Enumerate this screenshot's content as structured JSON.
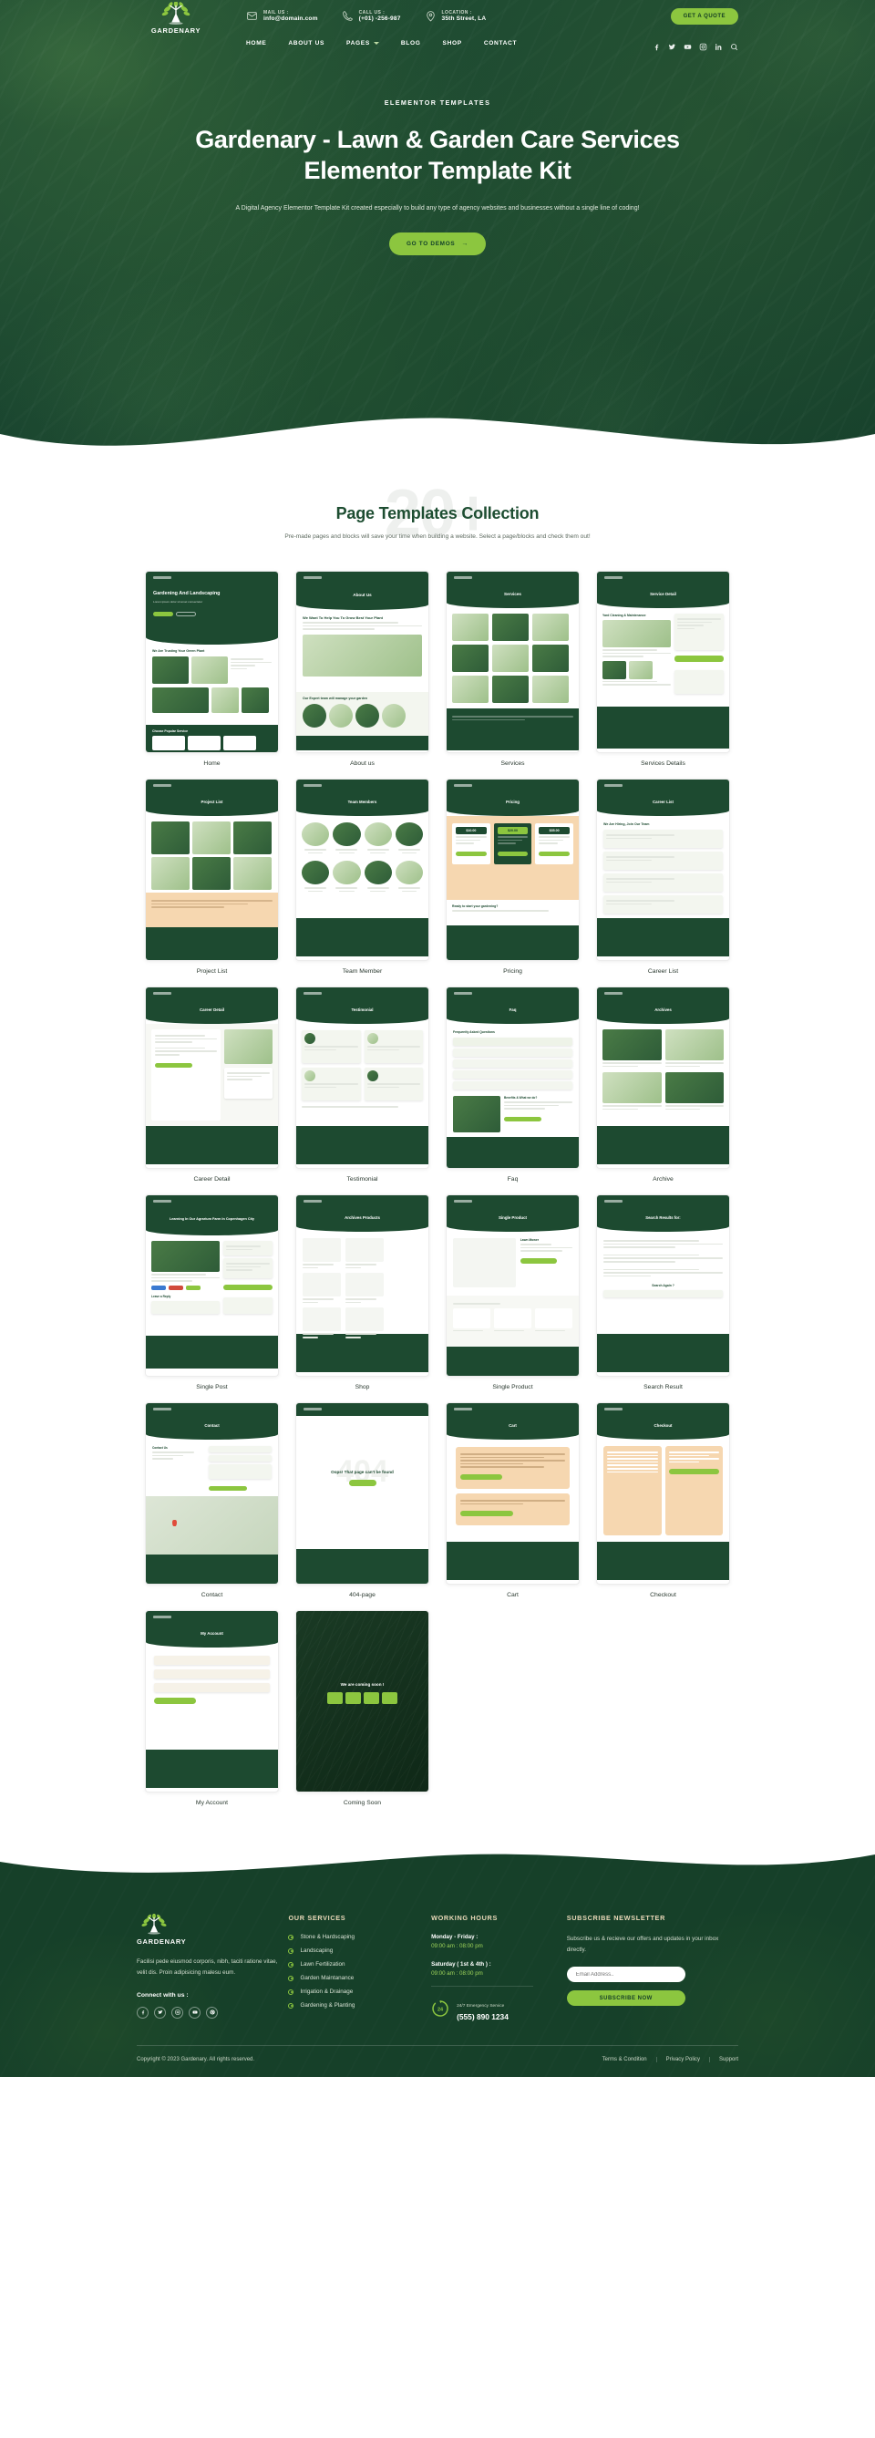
{
  "colors": {
    "brand_green": "#164029",
    "accent_lime": "#8cc63f",
    "dark_green": "#1d4a30",
    "cream": "#ead9b9"
  },
  "header": {
    "logo_name": "GARDENARY",
    "contacts": [
      {
        "icon": "envelope-icon",
        "label": "MAIL US :",
        "value": "info@domain.com"
      },
      {
        "icon": "phone-icon",
        "label": "CALL US :",
        "value": "(+01) -256-987"
      },
      {
        "icon": "map-pin-icon",
        "label": "LOCATION :",
        "value": "35th Street, LA"
      }
    ],
    "quote_button": "GET A QUOTE",
    "nav": [
      {
        "label": "HOME",
        "has_dropdown": false
      },
      {
        "label": "ABOUT US",
        "has_dropdown": false
      },
      {
        "label": "PAGES",
        "has_dropdown": true
      },
      {
        "label": "BLOG",
        "has_dropdown": false
      },
      {
        "label": "SHOP",
        "has_dropdown": false
      },
      {
        "label": "CONTACT",
        "has_dropdown": false
      }
    ],
    "social": [
      "facebook-icon",
      "twitter-icon",
      "youtube-icon",
      "instagram-icon",
      "linkedin-icon",
      "search-icon"
    ]
  },
  "hero": {
    "kicker": "ELEMENTOR TEMPLATES",
    "title": "Gardenary - Lawn & Garden Care Services Elementor Template Kit",
    "subtitle": "A Digital Agency Elementor Template Kit created especially to build any type of  agency websites and businesses without a single line of coding!",
    "cta": "GO TO DEMOS",
    "cta_arrow": "→"
  },
  "templates_section": {
    "ghost_number": "20+",
    "title": "Page Templates Collection",
    "subtitle": "Pre-made pages and blocks will save your time when building a website. Select a page/blocks and check them out!",
    "cards": [
      {
        "label": "Home",
        "variant": "home"
      },
      {
        "label": "About us",
        "variant": "about"
      },
      {
        "label": "Services",
        "variant": "services"
      },
      {
        "label": "Services Details",
        "variant": "servicedetail"
      },
      {
        "label": "Project List",
        "variant": "projectlist"
      },
      {
        "label": "Team Member",
        "variant": "team"
      },
      {
        "label": "Pricing",
        "variant": "pricing"
      },
      {
        "label": "Career List",
        "variant": "careerlist"
      },
      {
        "label": "Career Detail",
        "variant": "careerdetail"
      },
      {
        "label": "Testimonial",
        "variant": "testimonial"
      },
      {
        "label": "Faq",
        "variant": "faq"
      },
      {
        "label": "Archive",
        "variant": "archive"
      },
      {
        "label": "Single Post",
        "variant": "singlepost"
      },
      {
        "label": "Shop",
        "variant": "shop"
      },
      {
        "label": "Single Product",
        "variant": "singleproduct"
      },
      {
        "label": "Search Result",
        "variant": "searchresult"
      },
      {
        "label": "Contact",
        "variant": "contact"
      },
      {
        "label": "404-page",
        "variant": "notfound"
      },
      {
        "label": "Cart",
        "variant": "cart"
      },
      {
        "label": "Checkout",
        "variant": "checkout"
      },
      {
        "label": "My Account",
        "variant": "myaccount"
      },
      {
        "label": "Coming Soon",
        "variant": "comingsoon"
      }
    ],
    "card_inner_titles": {
      "home": "Gardening And Landscaping",
      "about": "About Us",
      "services": "Services",
      "servicedetail": "Service Detail",
      "projectlist": "Project List",
      "team": "Team Members",
      "pricing": "Pricing",
      "careerlist": "Career List",
      "careerdetail": "Career Detail",
      "testimonial": "Testimonial",
      "faq": "Faq",
      "archive": "Archives",
      "singlepost": "Learning In Our Agrarium Farm In Copenhagen City",
      "shop": "Archives Products",
      "singleproduct": "Single Product",
      "searchresult": "Search Results for:",
      "contact": "Contact",
      "notfound": "Oops! That page can't be found",
      "cart": "Cart",
      "checkout": "Checkout",
      "myaccount": "My Account",
      "comingsoon": "We are coming soon !"
    }
  },
  "footer": {
    "logo_name": "GARDENARY",
    "about": "Facilisi pede eiusmod corporis, nibh, taciti ratione vitae, velit dis. Proin adipisicing malesu eum.",
    "connect_label": "Connect with us :",
    "socials": [
      "facebook-icon",
      "twitter-icon",
      "instagram-icon",
      "youtube-icon",
      "pinterest-icon"
    ],
    "services": {
      "heading": "OUR SERVICES",
      "items": [
        "Stone & Hardscaping",
        "Landscaping",
        "Lawn Fertilization",
        "Garden Maintanance",
        "Irrigation & Drainage",
        "Gardening & Planting"
      ]
    },
    "hours": {
      "heading": "WORKING HOURS",
      "rows": [
        {
          "day": "Monday - Friday :",
          "time": "09:00 am : 08:00 pm"
        },
        {
          "day": "Saturday ( 1st & 4th ) :",
          "time": "09:00 am : 08:00 pm"
        }
      ],
      "emergency_label": "24/7 Emergency Service",
      "emergency_number": "(555) 890 1234",
      "emergency_icon": "24h-support-icon"
    },
    "newsletter": {
      "heading": "SUBSCRIBE NEWSLETTER",
      "text": "Subscribe us & recieve our offers and updates in your inbox directly.",
      "placeholder": "Email Address..",
      "input_value": "",
      "button": "SUBSCRIBE NOW"
    },
    "copyright": "Copyright © 2023 Gardenary. All rights reserved.",
    "links": [
      "Terms & Condition",
      "Privacy Policy",
      "Support"
    ]
  }
}
